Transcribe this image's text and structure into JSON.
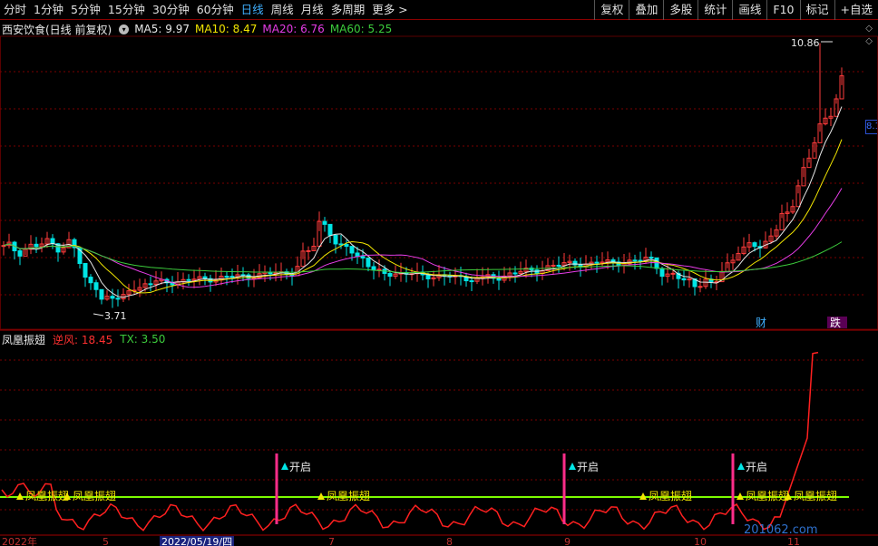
{
  "toolbar": {
    "periods": [
      "分时",
      "1分钟",
      "5分钟",
      "15分钟",
      "30分钟",
      "60分钟",
      "日线",
      "周线",
      "月线",
      "多周期",
      "更多 >"
    ],
    "active_period": "日线",
    "right_buttons": [
      "复权",
      "叠加",
      "多股",
      "统计",
      "画线",
      "F10",
      "标记",
      "+自选"
    ]
  },
  "main_panel": {
    "title": "西安饮食(日线 前复权)",
    "ma_labels": [
      {
        "text": "MA5: 9.97",
        "color": "#e8e8e8"
      },
      {
        "text": "MA10: 8.47",
        "color": "#f2e600"
      },
      {
        "text": "MA20: 6.76",
        "color": "#e63ce6"
      },
      {
        "text": "MA60: 5.25",
        "color": "#3ccc3c"
      }
    ],
    "high_label": "10.86",
    "low_label": "3.71",
    "right_price": "8.1",
    "event_tags": [
      "财",
      "跌"
    ]
  },
  "indicator_panel": {
    "name": "凤凰振翅",
    "values": [
      {
        "text": "逆风: 18.45",
        "color": "#ff3030"
      },
      {
        "text": "TX: 3.50",
        "color": "#3ccc3c"
      }
    ],
    "open_label": "开启",
    "signal_label": "凤凰振翅"
  },
  "x_axis": {
    "labels": [
      "2022年",
      "5",
      "2022/05/19/四",
      "7",
      "8",
      "9",
      "10",
      "11"
    ]
  },
  "watermark": "201062.com",
  "colors": {
    "up": "#ff3b3b",
    "down": "#00e5e5",
    "grid": "#7a0000",
    "ma5": "#e8e8e8",
    "ma10": "#f2e600",
    "ma20": "#e63ce6",
    "ma60": "#3ccc3c",
    "indicator": "#ff2020",
    "tx_line": "#7cfc00",
    "open_marker": "#ff2d8a"
  }
}
